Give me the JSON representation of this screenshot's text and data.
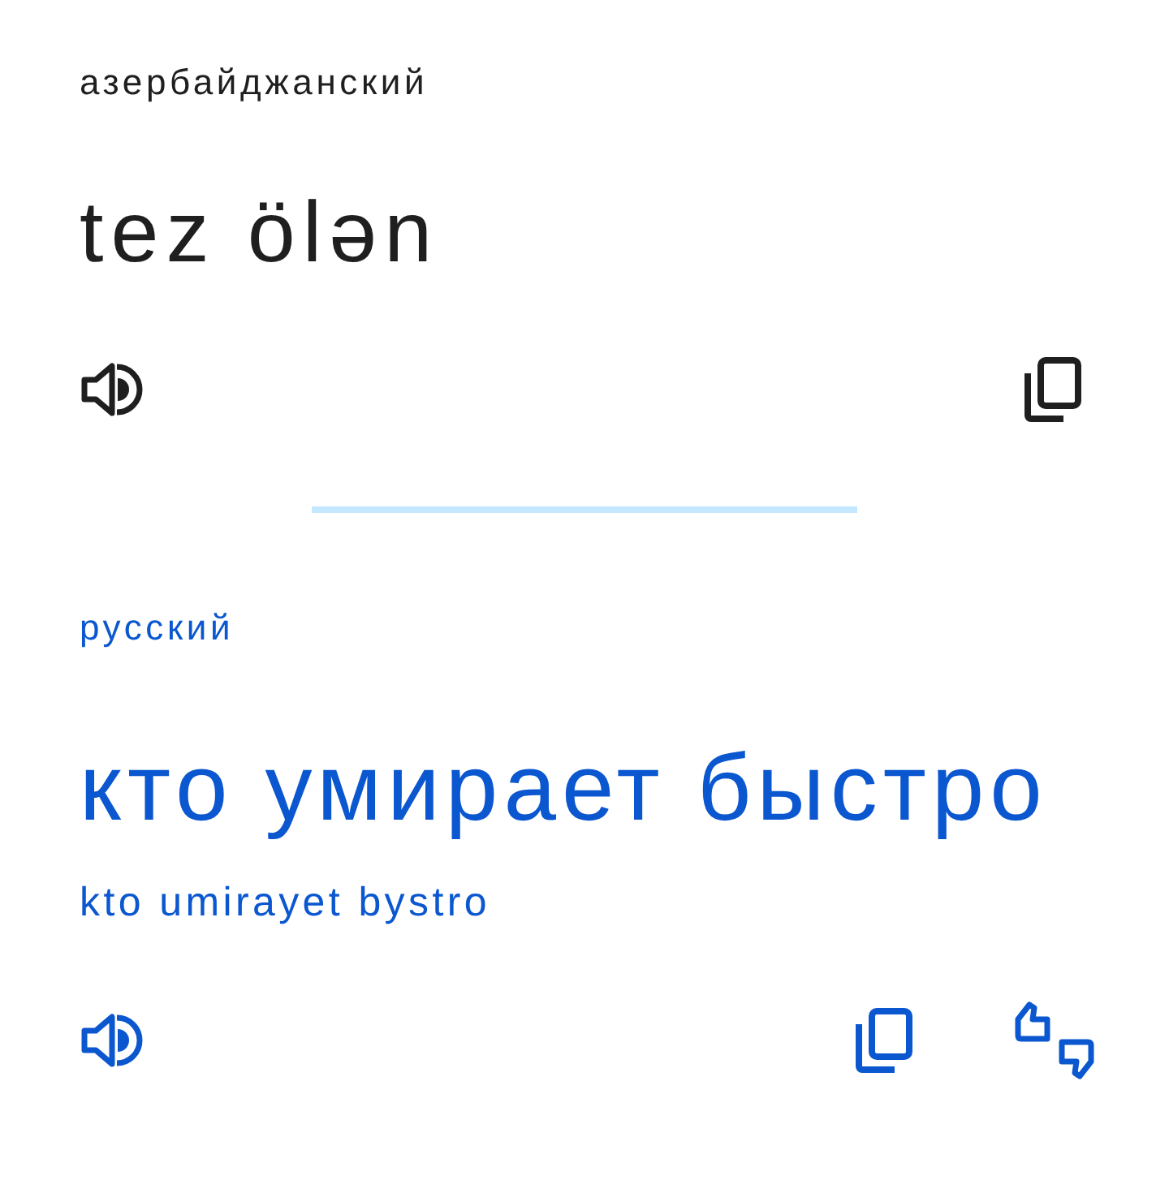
{
  "source": {
    "language": "азербайджанский",
    "text": "tez ölən"
  },
  "target": {
    "language": "русский",
    "text": "кто умирает быстро",
    "transliteration": "kto umirayet bystro"
  }
}
